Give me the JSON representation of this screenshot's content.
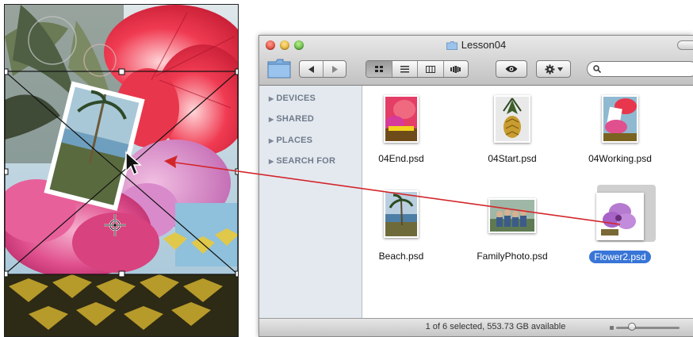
{
  "canvas": {
    "document": "photoshop-composite",
    "selection": "free-transform-box"
  },
  "finder": {
    "title": "Lesson04",
    "toolbar": {
      "back_icon": "triangle-left-icon",
      "forward_icon": "triangle-right-icon",
      "views": [
        "icon-view-icon",
        "list-view-icon",
        "column-view-icon",
        "cover-flow-icon"
      ],
      "active_view": 0,
      "quicklook_icon": "eye-icon",
      "action_icon": "gear-icon",
      "search_placeholder": ""
    },
    "sidebar": {
      "items": [
        {
          "label": "DEVICES"
        },
        {
          "label": "SHARED"
        },
        {
          "label": "PLACES"
        },
        {
          "label": "SEARCH FOR"
        }
      ]
    },
    "files": [
      {
        "name": "04End.psd"
      },
      {
        "name": "04Start.psd"
      },
      {
        "name": "04Working.psd"
      },
      {
        "name": "Beach.psd"
      },
      {
        "name": "FamilyPhoto.psd"
      },
      {
        "name": "Flower2.psd",
        "selected": true
      }
    ],
    "status_text": "1 of 6 selected, 553.73 GB available"
  },
  "colors": {
    "arrow": "#d3262b",
    "selection_blue": "#3875d7"
  }
}
